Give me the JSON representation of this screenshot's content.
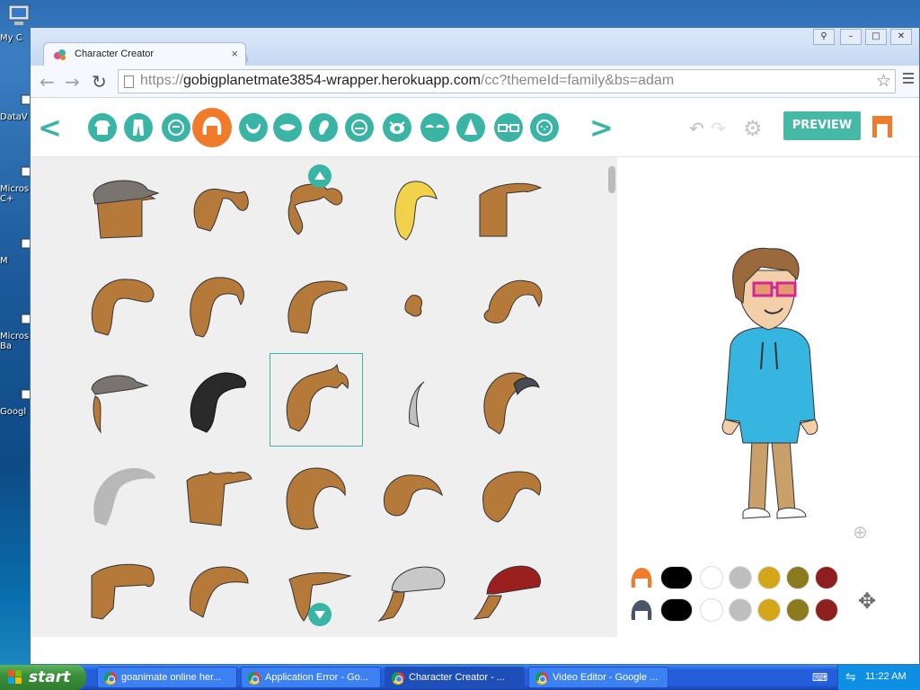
{
  "desktop": {
    "icons": [
      "My C",
      "DataV",
      "Micros C+",
      "M",
      "Micros Ba",
      "Googl"
    ]
  },
  "browser": {
    "tab_title": "Character Creator",
    "tab_close": "×",
    "url_prefix": "https://",
    "url_host": "gobigplanetmate3854-wrapper.herokuapp.com",
    "url_path": "/cc?themeId=family&bs=adam"
  },
  "app": {
    "categories": [
      "shirt",
      "pants",
      "face-shape",
      "hair",
      "facial-hair",
      "mouth",
      "ear",
      "eyebrow-line",
      "eyes",
      "eyebrows",
      "nose",
      "glasses",
      "freckles"
    ],
    "selected_category": "hair",
    "preview_label": "PREVIEW",
    "hair_grid_rows": 5,
    "hair_grid_cols": 5,
    "selected_hair_index": 12,
    "swatch_colors": [
      "#000000",
      "#ffffff",
      "#bebebe",
      "#d3a719",
      "#8c7a1f",
      "#8e1f1f"
    ]
  },
  "taskbar": {
    "start_label": "start",
    "tasks": [
      "goanimate online her...",
      "Application Error - Go...",
      "Character Creator - ...",
      "Video Editor - Google ..."
    ],
    "active_task": 2,
    "clock": "11:22 AM"
  }
}
